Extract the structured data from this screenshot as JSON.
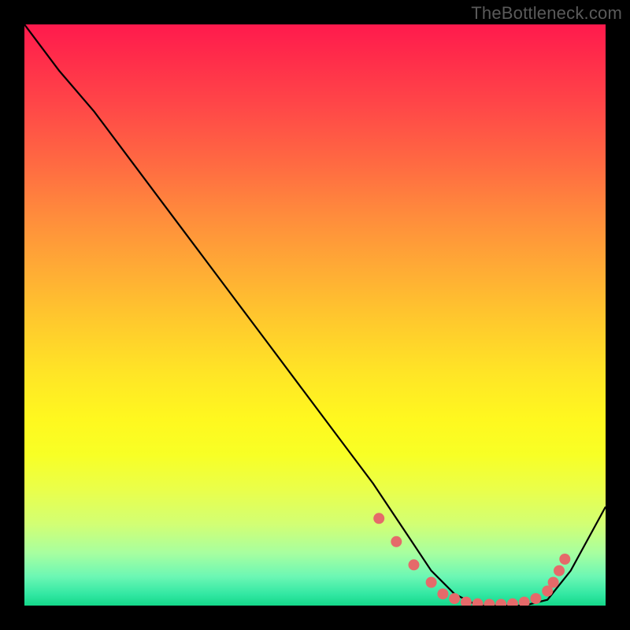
{
  "attribution": "TheBottleneck.com",
  "chart_data": {
    "type": "line",
    "title": "",
    "xlabel": "",
    "ylabel": "",
    "xlim": [
      0,
      100
    ],
    "ylim": [
      0,
      100
    ],
    "series": [
      {
        "name": "curve",
        "x": [
          0,
          6,
          12,
          18,
          24,
          30,
          36,
          42,
          48,
          54,
          60,
          66,
          70,
          74,
          78,
          82,
          86,
          90,
          94,
          100
        ],
        "y": [
          100,
          92,
          85,
          77,
          69,
          61,
          53,
          45,
          37,
          29,
          21,
          12,
          6,
          2,
          0,
          0,
          0,
          1,
          6,
          17
        ]
      }
    ],
    "markers": {
      "name": "highlight-dots",
      "x": [
        61,
        64,
        67,
        70,
        72,
        74,
        76,
        78,
        80,
        82,
        84,
        86,
        88,
        90,
        91,
        92,
        93
      ],
      "y": [
        15,
        11,
        7,
        4,
        2,
        1.2,
        0.6,
        0.3,
        0.2,
        0.2,
        0.3,
        0.6,
        1.2,
        2.5,
        4,
        6,
        8
      ]
    },
    "background": "rainbow-vertical"
  }
}
